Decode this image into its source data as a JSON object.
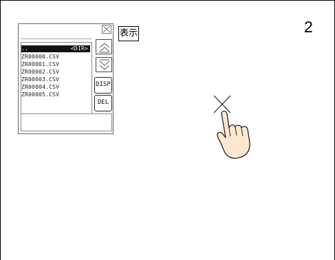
{
  "step": {
    "number": "2"
  },
  "file_list": {
    "selected_row": {
      "name": "..",
      "type": "<DIR>"
    },
    "files": [
      "ZR00000.CSV",
      "ZR00001.CSV",
      "ZR00002.CSV",
      "ZR00003.CSV",
      "ZR00004.CSV",
      "ZR00005.CSV"
    ],
    "buttons": {
      "scroll_up_icon": "double-chevron-up-icon",
      "scroll_down_icon": "double-chevron-down-icon",
      "disp_label": "DISP",
      "del_label": "DEL"
    }
  },
  "display_label": "表示",
  "touch_icon": "hand-touch-icon"
}
